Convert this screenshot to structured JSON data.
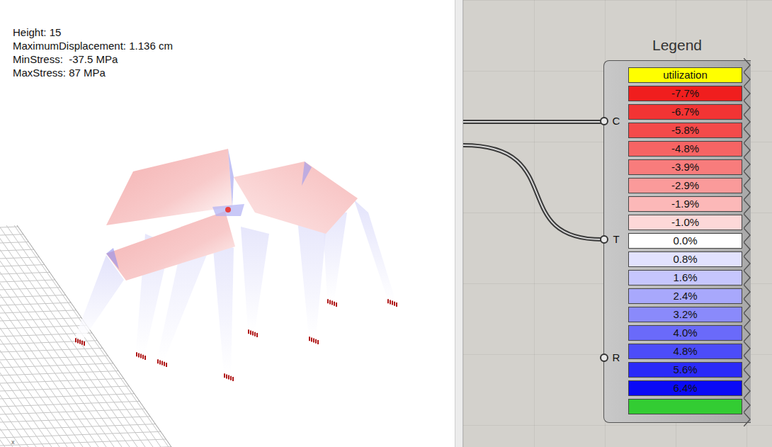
{
  "viewport": {
    "stats": [
      "Height: 15",
      "MaximumDisplacement: 1.136 cm",
      "MinStress:  -37.5 MPa",
      "MaxStress: 87 MPa"
    ],
    "axis_label": "x"
  },
  "legend": {
    "title": "Legend",
    "inputs": [
      {
        "label": "C",
        "connected": true
      },
      {
        "label": "T",
        "connected": true
      },
      {
        "label": "R",
        "connected": false
      }
    ],
    "items": [
      {
        "label": "utilization",
        "color": "#ffff00"
      },
      {
        "label": "-7.7%",
        "color": "#f01e1e"
      },
      {
        "label": "-6.7%",
        "color": "#f23434"
      },
      {
        "label": "-5.8%",
        "color": "#f44a4a"
      },
      {
        "label": "-4.8%",
        "color": "#f66464"
      },
      {
        "label": "-3.9%",
        "color": "#f87c7c"
      },
      {
        "label": "-2.9%",
        "color": "#fa9a9a"
      },
      {
        "label": "-1.9%",
        "color": "#fcb8b8"
      },
      {
        "label": "-1.0%",
        "color": "#fdd8d8"
      },
      {
        "label": "0.0%",
        "color": "#ffffff"
      },
      {
        "label": "0.8%",
        "color": "#e2e2fe"
      },
      {
        "label": "1.6%",
        "color": "#c6c6fd"
      },
      {
        "label": "2.4%",
        "color": "#a8a8fc"
      },
      {
        "label": "3.2%",
        "color": "#8a8afb"
      },
      {
        "label": "4.0%",
        "color": "#6a6afa"
      },
      {
        "label": "4.8%",
        "color": "#4c4cf9"
      },
      {
        "label": "5.6%",
        "color": "#2a2af8"
      },
      {
        "label": "6.4%",
        "color": "#0a0af6"
      },
      {
        "label": "",
        "color": "#33cc33"
      }
    ]
  }
}
